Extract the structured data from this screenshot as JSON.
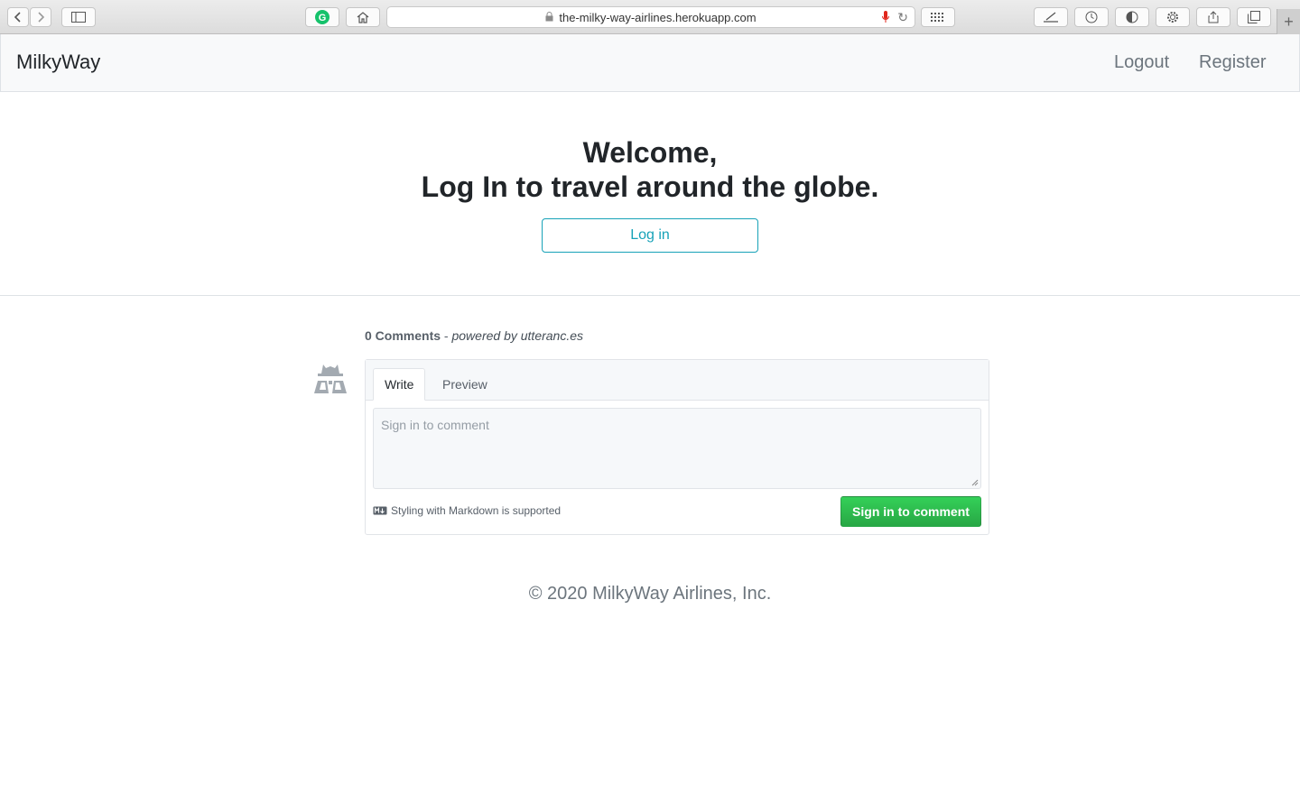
{
  "browser": {
    "url": "the-milky-way-airlines.herokuapp.com",
    "icons": [
      "back-icon",
      "forward-icon",
      "sidebar-icon",
      "grammarly-icon",
      "home-icon",
      "lock-icon",
      "microphone-icon",
      "reload-icon",
      "grid-icon",
      "annotate-icon",
      "history-icon",
      "shield-icon",
      "settings-icon",
      "share-icon",
      "tabs-icon",
      "new-tab-icon"
    ]
  },
  "navbar": {
    "brand": "MilkyWay",
    "links": [
      {
        "label": "Logout"
      },
      {
        "label": "Register"
      }
    ]
  },
  "hero": {
    "line1": "Welcome,",
    "line2": "Log In to travel around the globe.",
    "login_label": "Log in"
  },
  "comments": {
    "count_label": "0 Comments",
    "separator": " - ",
    "powered_by": "powered by utteranc.es",
    "tabs": [
      "Write",
      "Preview"
    ],
    "placeholder": "Sign in to comment",
    "markdown_note": "Styling with Markdown is supported",
    "submit_label": "Sign in to comment"
  },
  "footer": {
    "text": "© 2020 MilkyWay Airlines, Inc."
  },
  "colors": {
    "accent": "#17a2b8",
    "submit": "#28a745",
    "nav_bg": "#f8f9fa"
  }
}
